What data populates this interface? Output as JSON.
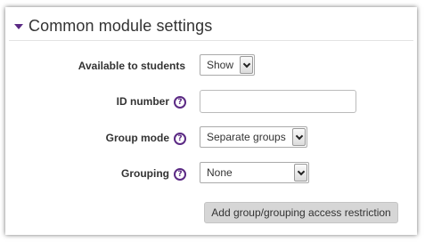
{
  "section": {
    "title": "Common module settings",
    "expanded": true
  },
  "fields": {
    "visibility": {
      "label": "Available to students",
      "value": "Show"
    },
    "idnumber": {
      "label": "ID number",
      "value": ""
    },
    "groupmode": {
      "label": "Group mode",
      "value": "Separate groups"
    },
    "grouping": {
      "label": "Grouping",
      "value": "None"
    }
  },
  "help_glyph": "?",
  "add_restriction_button": {
    "label": "Add group/grouping access restriction"
  },
  "colors": {
    "accent": "#5b2a84",
    "button_bg": "#d6d6d6"
  },
  "icons": [
    "collapse-triangle-icon",
    "help-icon",
    "dropdown-arrow-icon"
  ]
}
